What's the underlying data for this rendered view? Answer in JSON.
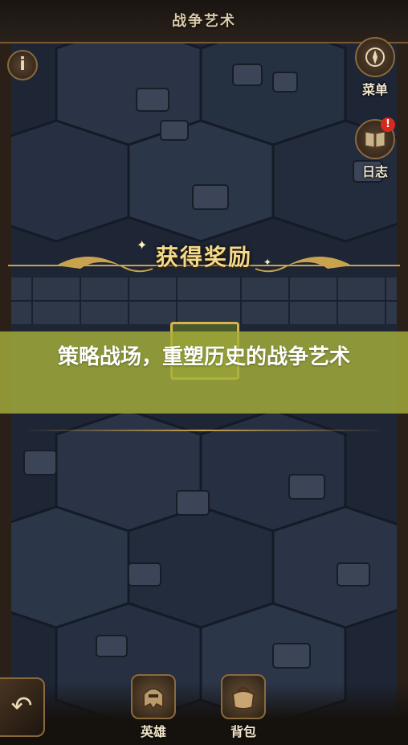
{
  "header": {
    "title": "战争艺术"
  },
  "side_menu": {
    "menu_label": "菜单",
    "log_label": "日志",
    "log_badge": "!"
  },
  "info_icon_glyph": "i",
  "reward": {
    "title": "获得奖励"
  },
  "headline": {
    "text": "策略战场，重塑历史的战争艺术"
  },
  "bottom_nav": {
    "hero_label": "英雄",
    "bag_label": "背包",
    "back_glyph": "↶"
  },
  "colors": {
    "headline_bg": "#a6b03a",
    "gold": "#d8b54c",
    "map_tile": "#2a3446"
  }
}
